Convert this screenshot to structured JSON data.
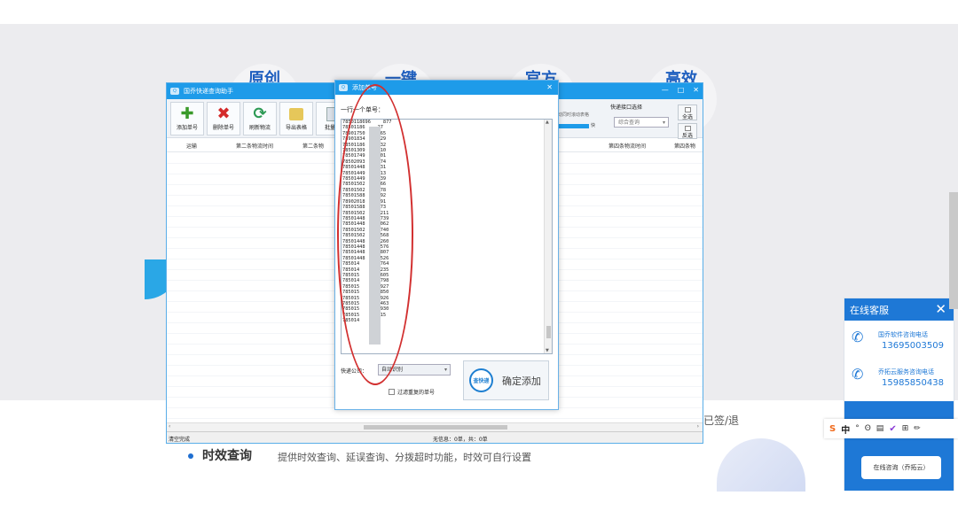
{
  "page": {
    "banner_titles": [
      "原创",
      "一键",
      "官方",
      "高效"
    ],
    "feature": {
      "title": "时效查询",
      "desc": "提供时效查询、延误查询、分拨超时功能，时效可自行设置"
    },
    "bg_text": "已签/退"
  },
  "mainwin": {
    "title": "国乔快递查询助手",
    "controls": [
      "—",
      "□",
      "✕"
    ],
    "toolbar": [
      {
        "label": "添加单号",
        "icon": "plus-icon"
      },
      {
        "label": "删除单号",
        "icon": "delete-icon"
      },
      {
        "label": "刷新物流",
        "icon": "refresh-icon"
      },
      {
        "label": "导出表格",
        "icon": "export-icon"
      },
      {
        "label": "批量查",
        "icon": "batch-icon"
      }
    ],
    "interface_label": "快递接口选择",
    "scroll_hint": "自动同时滚动表格",
    "progress_label": "快",
    "query_select": "综合查询",
    "select_all": "全选",
    "invert": "反选",
    "columns": [
      "运输",
      "第二条物流时间",
      "第二条物",
      "第四条物流时间",
      "第四条物"
    ],
    "status_left": "清空完成",
    "status_center": "无信息：0单，共：0单"
  },
  "dialog": {
    "title": "添加单号",
    "close": "✕",
    "hint": "一行一个单号：",
    "numbers": [
      "7850118696",
      "78501186",
      "78901750",
      "78901834",
      "78501186",
      "78501309",
      "78501749",
      "78502093",
      "78501448",
      "78501449",
      "78501449",
      "78501502",
      "78501502",
      "78501588",
      "78902018",
      "78501588",
      "78501502",
      "78501448",
      "78501448",
      "78501502",
      "78501502",
      "78501448",
      "78501448",
      "78501448",
      "78501448",
      "785014",
      "785014",
      "785015",
      "785014",
      "785015",
      "785015",
      "785015",
      "785015",
      "785015",
      "785015",
      "785014"
    ],
    "numbers_tail": [
      "877",
      "27",
      "765",
      "329",
      "832",
      "510",
      "501",
      "274",
      "131",
      "113",
      "139",
      "366",
      "678",
      "792",
      "991",
      "773",
      "4211",
      "5739",
      "3062",
      "4740",
      "0568",
      "6260",
      "7576",
      "3807",
      "5526",
      "369764",
      "463235",
      "363605",
      "562798",
      "086927",
      "871850",
      "371926",
      "099463",
      "996930",
      "85315",
      ""
    ],
    "courier_label": "快递公司：",
    "courier_select": "自动识别",
    "filter_label": "过滤重复的单号",
    "confirm_logo": "查快递",
    "confirm_label": "确定添加"
  },
  "cs": {
    "title": "在线客服",
    "close": "✕",
    "items": [
      {
        "title": "国乔软件咨询电话",
        "number": "13695003509"
      },
      {
        "title": "乔拓云服务咨询电话",
        "number": "15985850438"
      }
    ],
    "button": "在线咨询（乔拓云）"
  },
  "ime": {
    "items": [
      "S",
      "中",
      "°",
      "ʘ",
      "▤",
      "✔",
      "⊞",
      "✏"
    ]
  }
}
